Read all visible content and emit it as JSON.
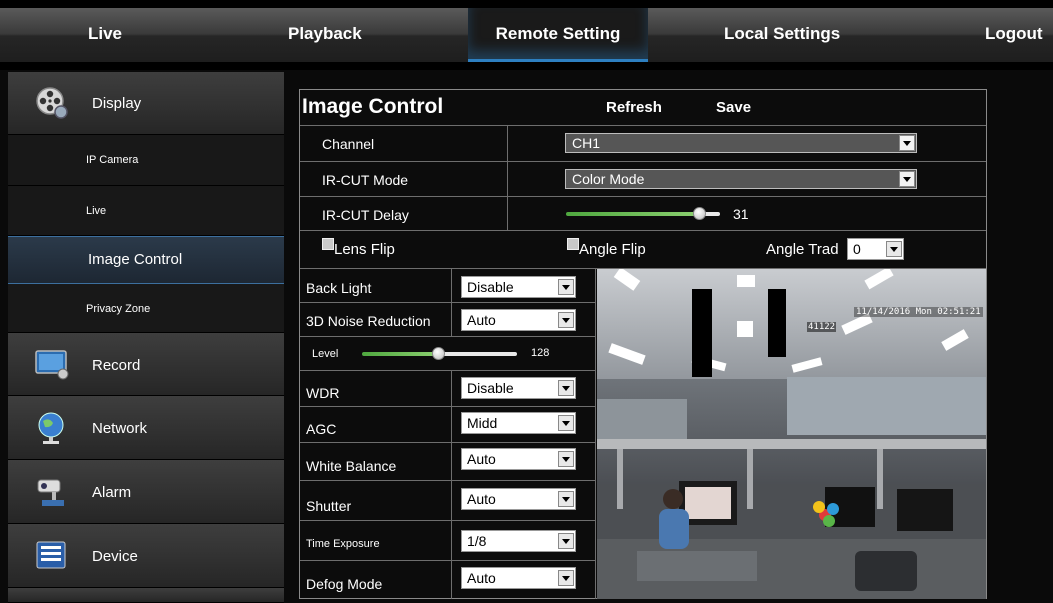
{
  "topnav": {
    "tabs": [
      {
        "label": "Live"
      },
      {
        "label": "Playback"
      },
      {
        "label": "Remote Setting",
        "active": true
      },
      {
        "label": "Local Settings"
      },
      {
        "label": "Logout"
      }
    ]
  },
  "sidebar": {
    "items": [
      {
        "label": "Display",
        "icon": "film-reel-icon",
        "level": "main"
      },
      {
        "label": "IP Camera",
        "level": "sub"
      },
      {
        "label": "Live",
        "level": "sub"
      },
      {
        "label": "Image Control",
        "level": "sub",
        "active": true
      },
      {
        "label": "Privacy Zone",
        "level": "sub"
      },
      {
        "label": "Record",
        "icon": "monitor-icon",
        "level": "main"
      },
      {
        "label": "Network",
        "icon": "globe-icon",
        "level": "main"
      },
      {
        "label": "Alarm",
        "icon": "security-camera-icon",
        "level": "main"
      },
      {
        "label": "Device",
        "icon": "hard-drive-icon",
        "level": "main"
      }
    ]
  },
  "panel": {
    "title": "Image Control",
    "refresh_label": "Refresh",
    "save_label": "Save",
    "channel": {
      "label": "Channel",
      "value": "CH1"
    },
    "ircut_mode": {
      "label": "IR-CUT Mode",
      "value": "Color Mode"
    },
    "ircut_delay": {
      "label": "IR-CUT Delay",
      "value": "31",
      "fraction": 0.88
    },
    "lens_flip": {
      "label": "Lens Flip",
      "checked": false
    },
    "angle_flip": {
      "label": "Angle Flip",
      "checked": false
    },
    "angle_trad": {
      "label": "Angle Trad",
      "value": "0"
    },
    "back_light": {
      "label": "Back Light",
      "value": "Disable"
    },
    "noise_reduction": {
      "label": "3D Noise Reduction",
      "value": "Auto"
    },
    "level": {
      "label": "Level",
      "value": "128",
      "fraction": 0.5
    },
    "wdr": {
      "label": "WDR",
      "value": "Disable"
    },
    "agc": {
      "label": "AGC",
      "value": "Midd"
    },
    "white_balance": {
      "label": "White Balance",
      "value": "Auto"
    },
    "shutter": {
      "label": "Shutter",
      "value": "Auto"
    },
    "time_exposure": {
      "label": "Time Exposure",
      "value": "1/8"
    },
    "defog_mode": {
      "label": "Defog Mode",
      "value": "Auto"
    }
  },
  "video": {
    "timestamp": "11/14/2016 Mon 02:51:21",
    "id_label": "41122"
  },
  "colors": {
    "accent": "#2d7fc0",
    "slider_green": "#6cc04a"
  }
}
